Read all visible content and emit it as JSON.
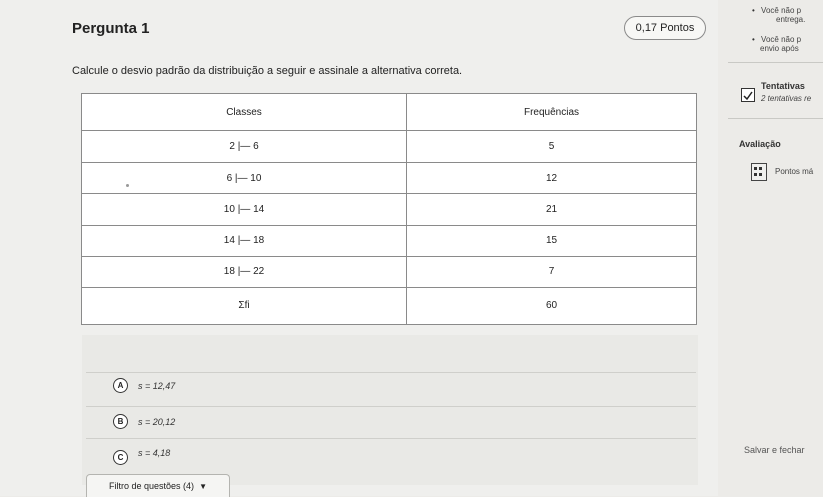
{
  "question": {
    "title": "Pergunta 1",
    "points": "0,17 Pontos",
    "statement": "Calcule o desvio padrão da distribuição a seguir e assinale a alternativa correta."
  },
  "table": {
    "headers": [
      "Classes",
      "Frequências"
    ],
    "rows": [
      [
        "2 |— 6",
        "5"
      ],
      [
        "6 |— 10",
        "12"
      ],
      [
        "10 |— 14",
        "21"
      ],
      [
        "14 |— 18",
        "15"
      ],
      [
        "18 |— 22",
        "7"
      ],
      [
        "Σfi",
        "60"
      ]
    ]
  },
  "options": [
    {
      "letter": "A",
      "text": "s = 12,47"
    },
    {
      "letter": "B",
      "text": "s = 20,12"
    },
    {
      "letter": "C",
      "text": "s = 4,18"
    }
  ],
  "footer": {
    "filter_label": "Filtro de questões (4)",
    "save_label": "Salvar e fechar"
  },
  "sidebar": {
    "note1_line1": "Você não p",
    "note1_line2": "entrega.",
    "note2_line1": "Você não p",
    "note2_line2": "envio após",
    "attempts_title": "Tentativas",
    "attempts_text": "2 tentativas re",
    "evaluation_title": "Avaliação",
    "evaluation_text": "Pontos má"
  }
}
